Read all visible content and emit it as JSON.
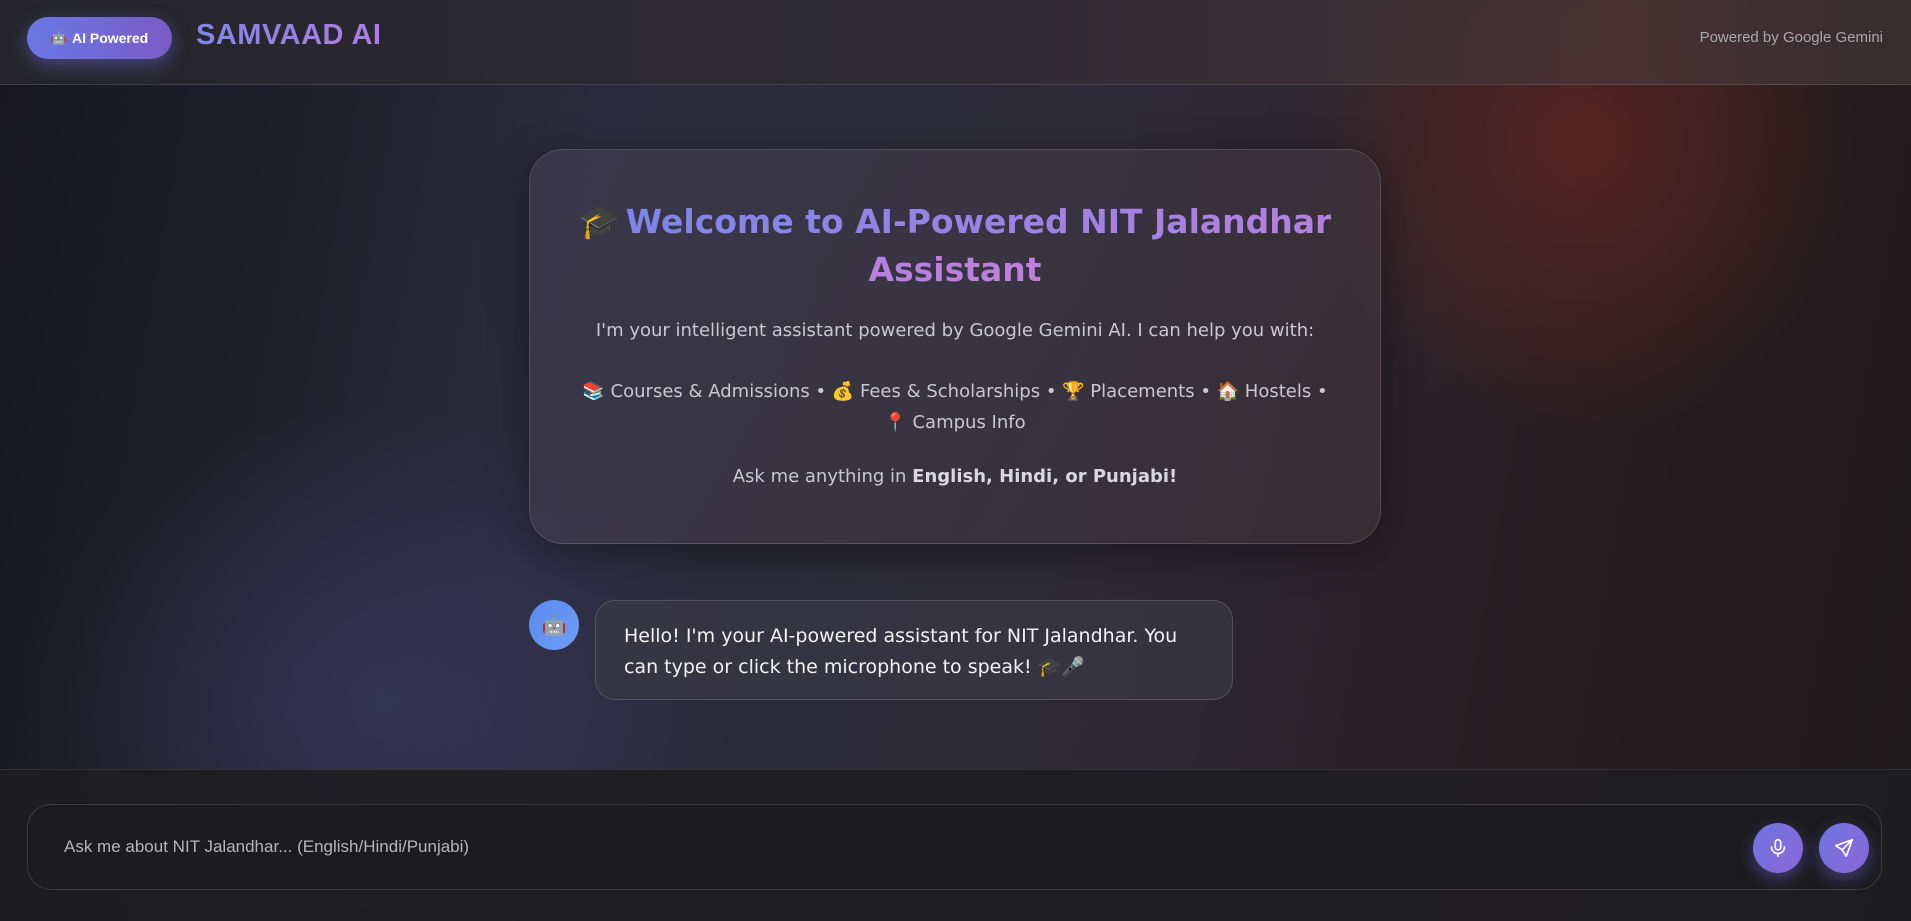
{
  "header": {
    "badge_icon": "robot-icon",
    "badge_emoji": "🤖",
    "badge_label": "AI Powered",
    "brand": "SAMVAAD AI",
    "powered_by": "Powered by Google Gemini"
  },
  "welcome": {
    "title_icon": "graduation-cap-icon",
    "title_emoji": "🎓",
    "title": "Welcome to AI-Powered NIT Jalandhar Assistant",
    "intro": "I'm your intelligent assistant powered by Google Gemini AI. I can help you with:",
    "topics": "📚 Courses & Admissions • 💰 Fees & Scholarships • 🏆 Placements • 🏠 Hostels • 📍 Campus Info",
    "ask_prefix": "Ask me anything in ",
    "ask_languages": "English, Hindi, or Punjabi!"
  },
  "messages": [
    {
      "sender": "bot",
      "avatar_icon": "robot-icon",
      "avatar_emoji": "🤖",
      "text": "Hello! I'm your AI-powered assistant for NIT Jalandhar. You can type or click the microphone to speak! 🎓🎤"
    }
  ],
  "composer": {
    "placeholder": "Ask me about NIT Jalandhar... (English/Hindi/Punjabi)",
    "value": "",
    "mic_icon": "microphone-icon",
    "send_icon": "send-icon"
  },
  "colors": {
    "accent_start": "#6a78e6",
    "accent_end": "#b07ce0",
    "avatar": "#5b8af0"
  }
}
